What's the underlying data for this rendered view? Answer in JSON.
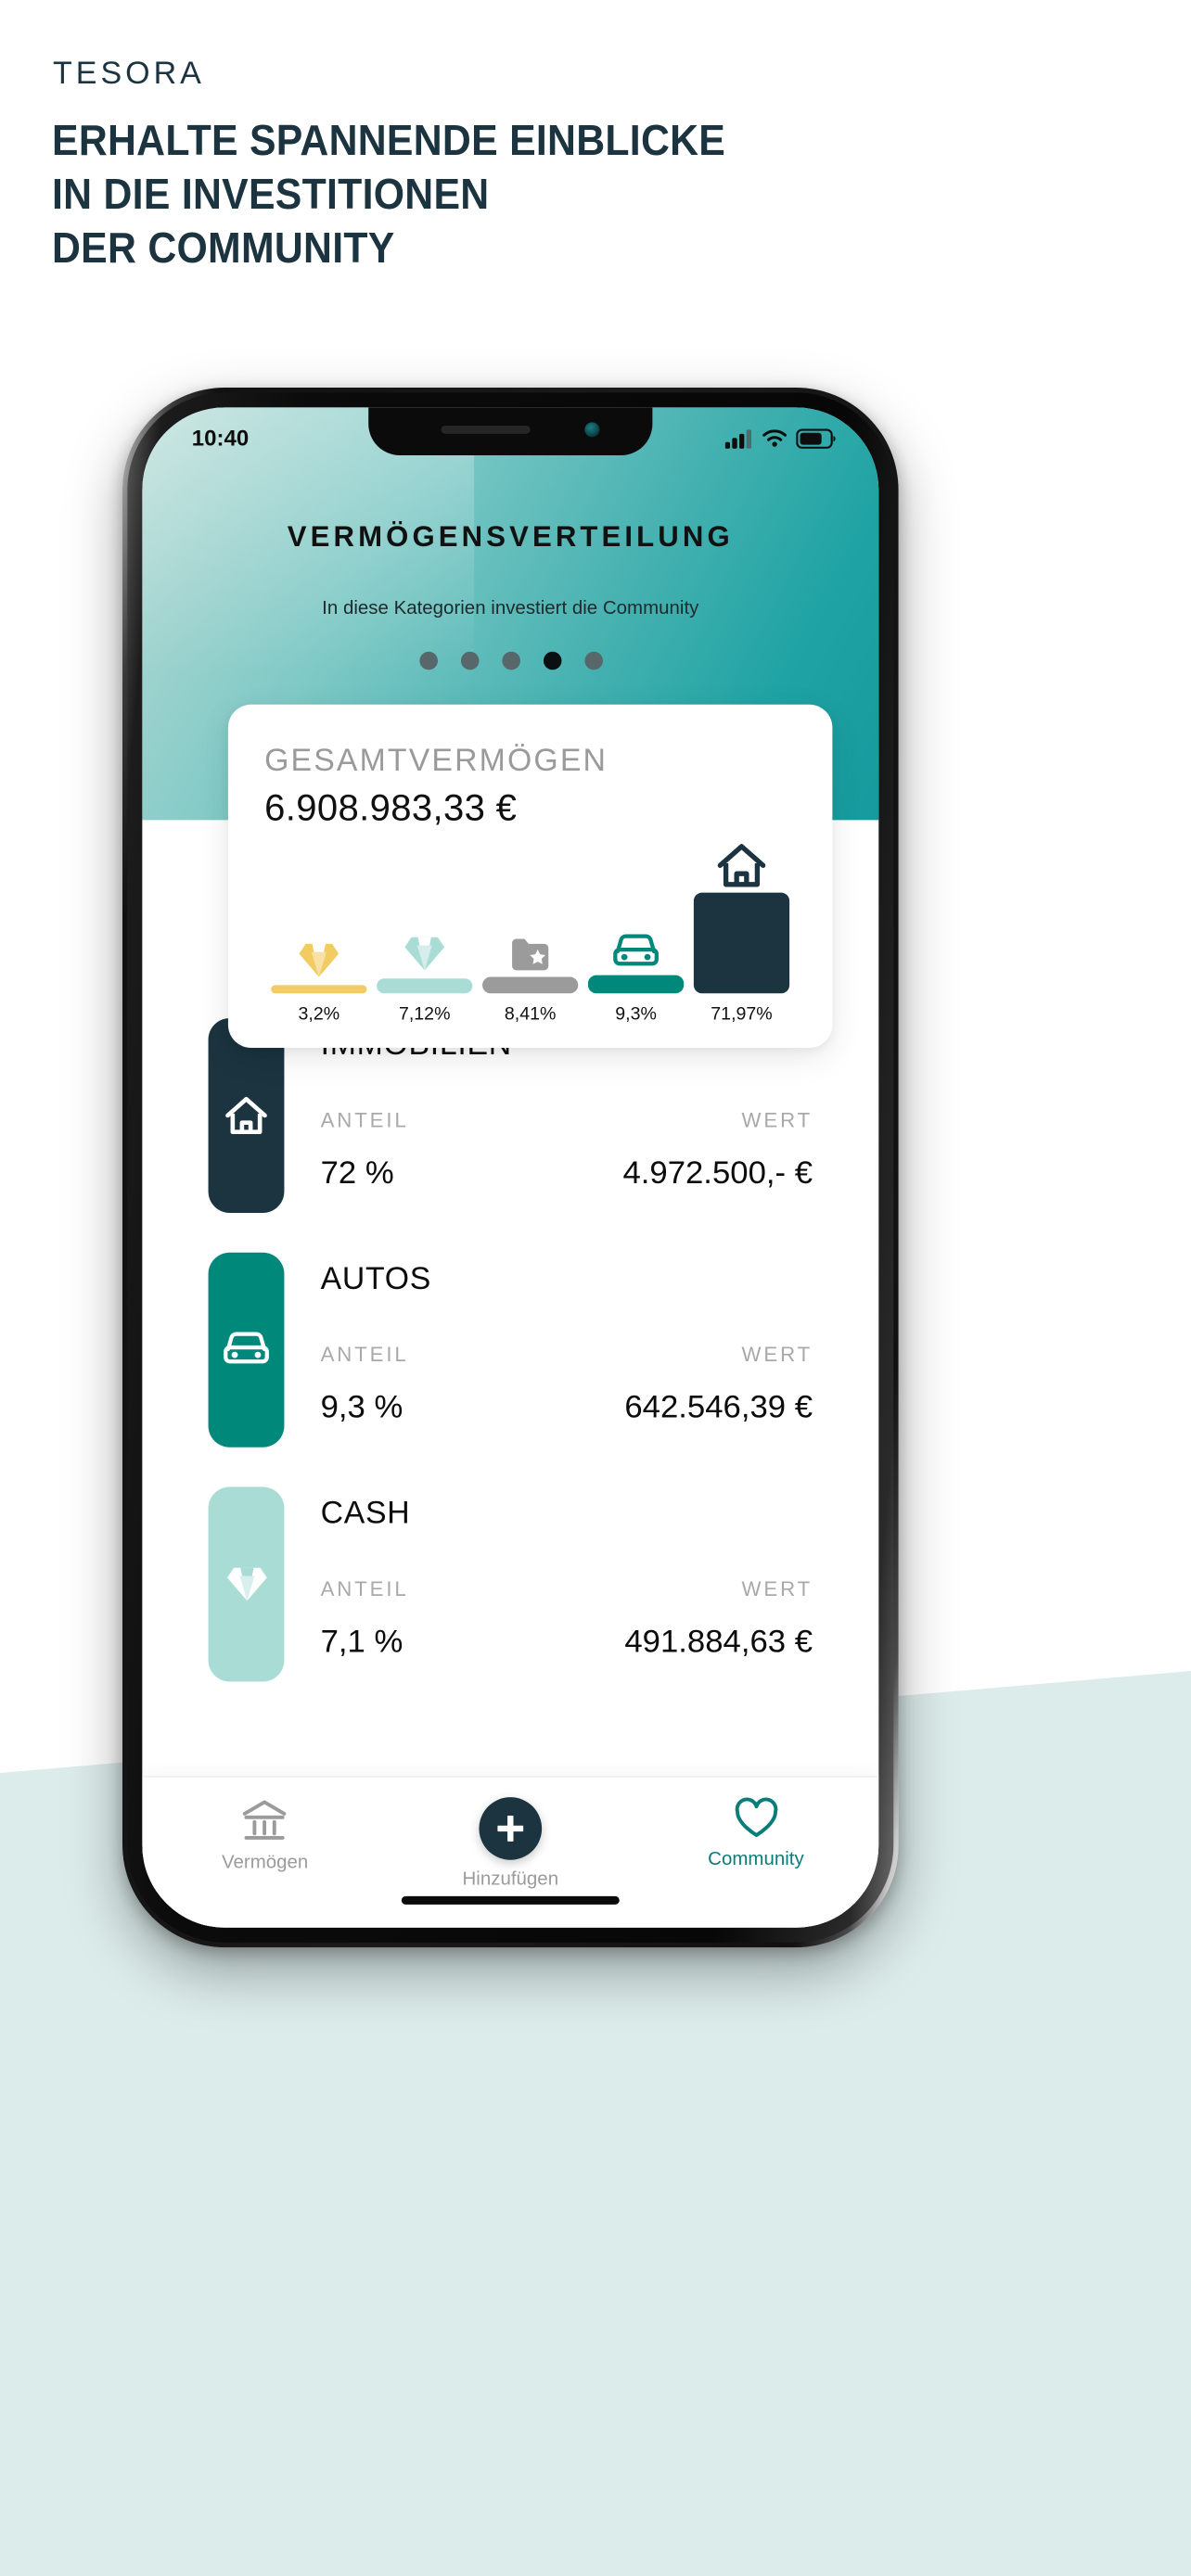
{
  "marketing": {
    "brand": "TESORA",
    "headline_lines": [
      "ERHALTE SPANNENDE EINBLICKE",
      "IN DIE INVESTITIONEN",
      "DER COMMUNITY"
    ],
    "text_color": "#1b3440",
    "bg_mint": "#dcecea"
  },
  "status_bar": {
    "time": "10:40",
    "signal_icon": "cellular-bars-icon",
    "wifi_icon": "wifi-icon",
    "battery_icon": "battery-icon"
  },
  "app_header": {
    "title": "VERMÖGENSVERTEILUNG",
    "subtitle": "In diese Kategorien investiert die Community",
    "pager": {
      "count": 5,
      "active_index": 3
    },
    "gradient_from": "#b9ddd8",
    "gradient_to": "#169a9d"
  },
  "total_card": {
    "label": "GESAMTVERMÖGEN",
    "value": "6.908.983,33 €"
  },
  "chart_data": {
    "type": "bar",
    "title": "GESAMTVERMÖGEN",
    "categories": [
      "Schmuck",
      "Cash",
      "Sonstiges",
      "Autos",
      "Immobilien"
    ],
    "tick_labels": [
      "3,2%",
      "7,12%",
      "8,41%",
      "9,3%",
      "71,97%"
    ],
    "values": [
      3.2,
      7.12,
      8.41,
      9.3,
      71.97
    ],
    "icons": [
      "diamond-gold-icon",
      "diamond-mint-icon",
      "folder-star-icon",
      "car-icon",
      "house-icon"
    ],
    "colors": [
      "#f3cb63",
      "#aadcd6",
      "#9b9b9b",
      "#00897b",
      "#1b3440"
    ],
    "ylabel": "",
    "xlabel": "",
    "ylim": [
      0,
      100
    ],
    "grid": false,
    "legend": "none"
  },
  "assets": {
    "share_header": "ANTEIL",
    "value_header": "WERT",
    "rows": [
      {
        "name": "IMMOBILIEN",
        "share": "72 %",
        "value": "4.972.500,- €",
        "color": "#1b3440",
        "icon": "house-icon"
      },
      {
        "name": "AUTOS",
        "share": "9,3 %",
        "value": "642.546,39 €",
        "color": "#00897b",
        "icon": "car-icon"
      },
      {
        "name": "CASH",
        "share": "7,1 %",
        "value": "491.884,63 €",
        "color": "#aadcd6",
        "icon": "diamond-icon"
      }
    ]
  },
  "tabbar": {
    "items": [
      {
        "label": "Vermögen",
        "icon": "bank-icon",
        "active": false
      },
      {
        "label": "Hinzufügen",
        "icon": "plus-icon",
        "active": false
      },
      {
        "label": "Community",
        "icon": "heart-icon",
        "active": true
      }
    ],
    "active_color": "#0b7d78",
    "inactive_color": "#9b9b9b"
  }
}
